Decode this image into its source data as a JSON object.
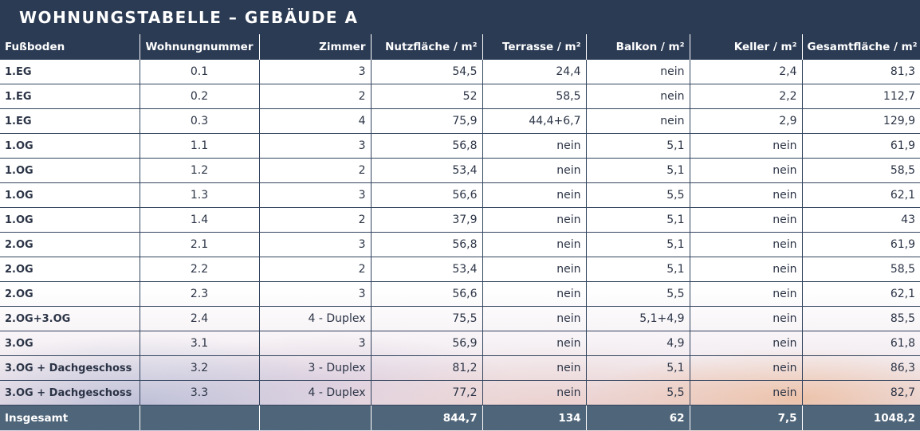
{
  "title": "WOHNUNGSTABELLE – GEBÄUDE A",
  "columns": [
    "Fußboden",
    "Wohnungnummer",
    "Zimmer",
    "Nutzfläche / m²",
    "Terrasse / m²",
    "Balkon / m²",
    "Keller / m²",
    "Gesamtfläche / m²"
  ],
  "rows": [
    [
      "1.EG",
      "0.1",
      "3",
      "54,5",
      "24,4",
      "nein",
      "2,4",
      "81,3"
    ],
    [
      "1.EG",
      "0.2",
      "2",
      "52",
      "58,5",
      "nein",
      "2,2",
      "112,7"
    ],
    [
      "1.EG",
      "0.3",
      "4",
      "75,9",
      "44,4+6,7",
      "nein",
      "2,9",
      "129,9"
    ],
    [
      "1.OG",
      "1.1",
      "3",
      "56,8",
      "nein",
      "5,1",
      "nein",
      "61,9"
    ],
    [
      "1.OG",
      "1.2",
      "2",
      "53,4",
      "nein",
      "5,1",
      "nein",
      "58,5"
    ],
    [
      "1.OG",
      "1.3",
      "3",
      "56,6",
      "nein",
      "5,5",
      "nein",
      "62,1"
    ],
    [
      "1.OG",
      "1.4",
      "2",
      "37,9",
      "nein",
      "5,1",
      "nein",
      "43"
    ],
    [
      "2.OG",
      "2.1",
      "3",
      "56,8",
      "nein",
      "5,1",
      "nein",
      "61,9"
    ],
    [
      "2.OG",
      "2.2",
      "2",
      "53,4",
      "nein",
      "5,1",
      "nein",
      "58,5"
    ],
    [
      "2.OG",
      "2.3",
      "3",
      "56,6",
      "nein",
      "5,5",
      "nein",
      "62,1"
    ],
    [
      "2.OG+3.OG",
      "2.4",
      "4 - Duplex",
      "75,5",
      "nein",
      "5,1+4,9",
      "nein",
      "85,5"
    ],
    [
      "3.OG",
      "3.1",
      "3",
      "56,9",
      "nein",
      "4,9",
      "nein",
      "61,8"
    ],
    [
      "3.OG + Dachgeschoss",
      "3.2",
      "3 - Duplex",
      "81,2",
      "nein",
      "5,1",
      "nein",
      "86,3"
    ],
    [
      "3.OG + Dachgeschoss",
      "3.3",
      "4 - Duplex",
      "77,2",
      "nein",
      "5,5",
      "nein",
      "82,7"
    ]
  ],
  "totals": [
    "Insgesamt",
    "",
    "",
    "844,7",
    "134",
    "62",
    "7,5",
    "1048,2"
  ],
  "colors": {
    "header_bg": "#2b3b54",
    "footer_bg": "#4f6579",
    "text": "#2b3446"
  }
}
